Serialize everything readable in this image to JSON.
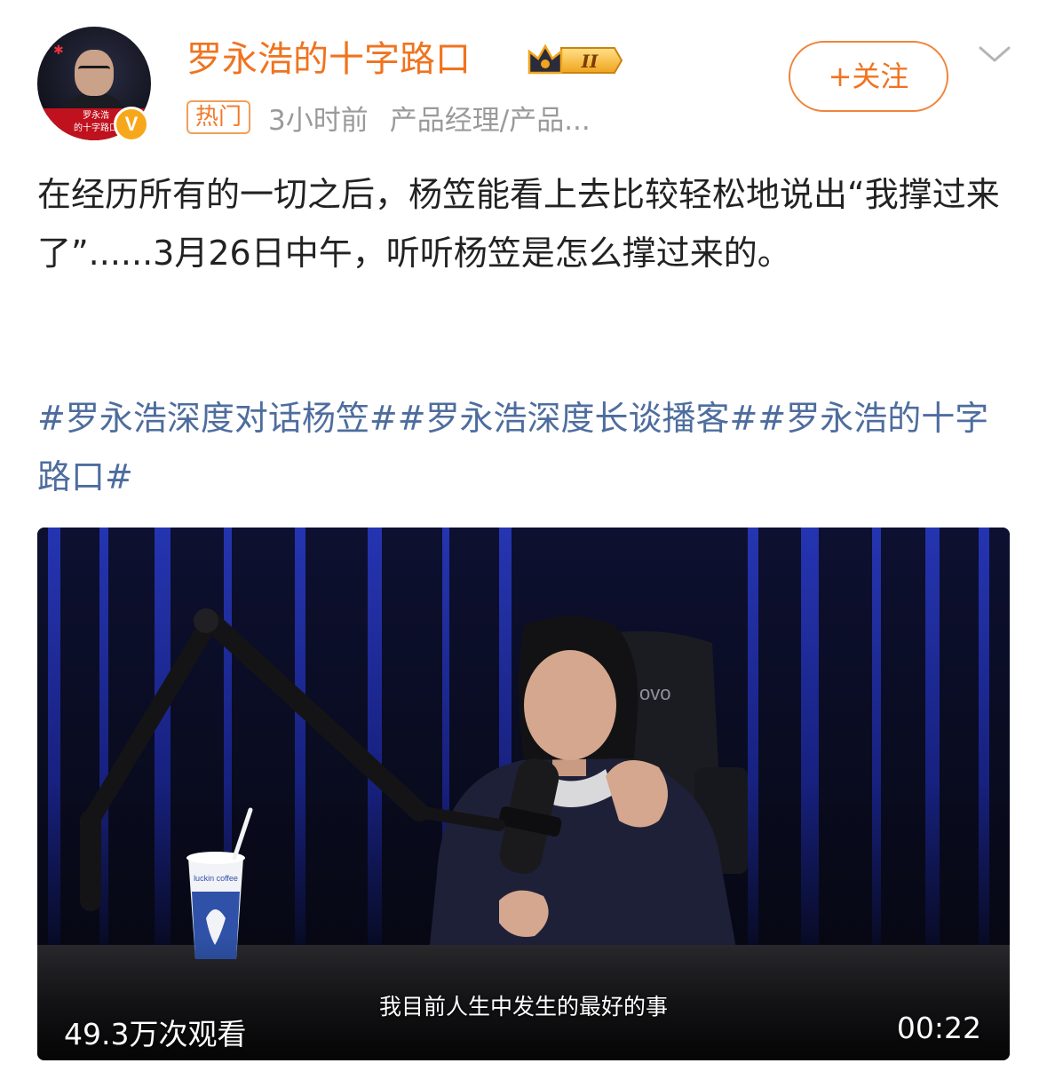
{
  "post": {
    "author": {
      "name": "罗永浩的十字路口",
      "avatar_caption": "罗永浩\n的十字路口",
      "verified_mark": "V",
      "level_badge": "II"
    },
    "meta": {
      "tag": "热门",
      "time": "3小时前",
      "source": "产品经理/产品..."
    },
    "follow_button_label": "+关注",
    "text": "在经历所有的一切之后，杨笠能看上去比较轻松地说出“我撑过来了”......3月26日中午，听听杨笠是怎么撑过来的。",
    "hashtags": [
      "#罗永浩深度对话杨笠#",
      "#罗永浩深度长谈播客#",
      "#罗永浩的十字路口#"
    ],
    "video": {
      "subtitle": "我目前人生中发生的最好的事",
      "views": "49.3万次观看",
      "duration": "00:22",
      "cup_brand": "luckin coffee",
      "chair_brand": "ovo"
    }
  },
  "colors": {
    "accent_orange": "#f0731f",
    "hashtag_blue": "#4e6d9e",
    "meta_gray": "#9a9a9a",
    "verified_gold": "#f7a81a"
  }
}
